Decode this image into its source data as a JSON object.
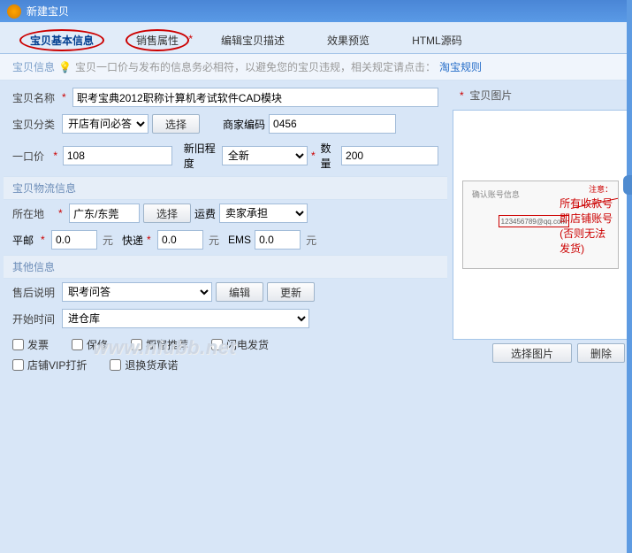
{
  "window": {
    "title": "新建宝贝"
  },
  "tabs": {
    "t0": "宝贝基本信息",
    "t1": "销售属性",
    "t2": "编辑宝贝描述",
    "t3": "效果预览",
    "t4": "HTML源码"
  },
  "banner": {
    "label": "宝贝信息",
    "text": "宝贝一口价与发布的信息务必相符，以避免您的宝贝违规，相关规定请点击：",
    "link": "淘宝规则"
  },
  "fields": {
    "name_label": "宝贝名称",
    "name_value": "职考宝典2012职称计算机考试软件CAD模块",
    "category_label": "宝贝分类",
    "category_value": "开店有问必答",
    "select_btn": "选择",
    "vendor_code_label": "商家编码",
    "vendor_code_value": "0456",
    "price_label": "一口价",
    "price_value": "108",
    "condition_label": "新旧程度",
    "condition_value": "全新",
    "qty_label": "数量",
    "qty_value": "200"
  },
  "logistics": {
    "group": "宝贝物流信息",
    "location_label": "所在地",
    "location_value": "广东/东莞",
    "select_btn": "选择",
    "freight_label": "运费",
    "freight_value": "卖家承担",
    "surface_label": "平邮",
    "surface_value": "0.0",
    "express_label": "快递",
    "express_value": "0.0",
    "ems_label": "EMS",
    "ems_value": "0.0",
    "unit": "元"
  },
  "other": {
    "group": "其他信息",
    "aftersale_label": "售后说明",
    "aftersale_value": "职考问答",
    "edit_btn": "编辑",
    "refresh_btn": "更新",
    "starttime_label": "开始时间",
    "starttime_value": "进仓库",
    "cb_invoice": "发票",
    "cb_warranty": "保修",
    "cb_showcase": "橱窗推荐",
    "cb_fast": "闪电发货",
    "cb_vip": "店铺VIP打折",
    "cb_return": "退换货承诺"
  },
  "image": {
    "title": "宝贝图片",
    "select_btn": "选择图片",
    "delete_btn": "删除",
    "ph_title": "确认账号信息",
    "ph_note": "注意：",
    "ph_red1": "所有收款号即店铺账号",
    "ph_red2": "(否则无法发货)"
  },
  "watermark": "www.niubb.net"
}
